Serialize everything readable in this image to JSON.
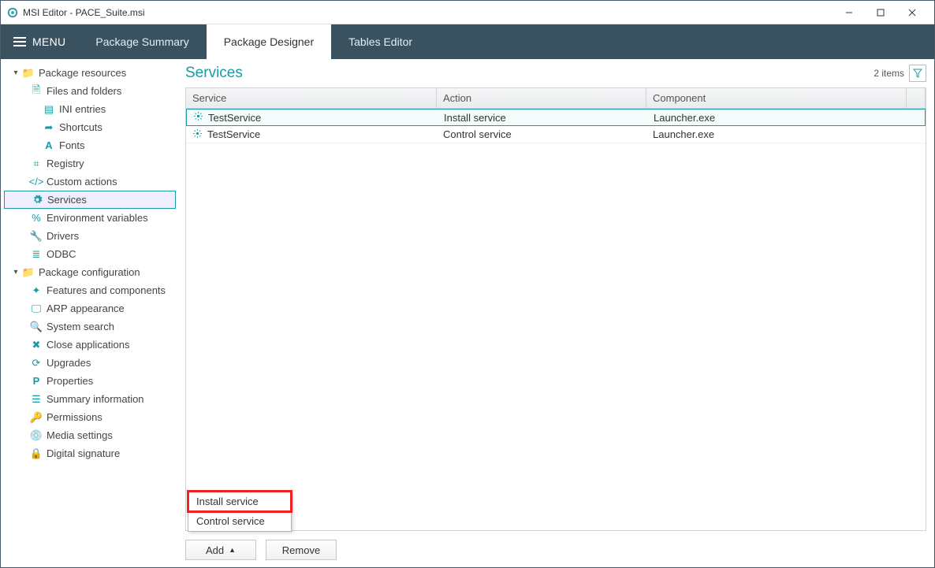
{
  "window": {
    "title": "MSI Editor - PACE_Suite.msi"
  },
  "menubar": {
    "menu_label": "MENU",
    "tabs": [
      {
        "label": "Package Summary",
        "active": false
      },
      {
        "label": "Package Designer",
        "active": true
      },
      {
        "label": "Tables Editor",
        "active": false
      }
    ]
  },
  "sidebar": {
    "sections": [
      {
        "label": "Package resources",
        "items": [
          {
            "label": "Files and folders",
            "icon": "file"
          },
          {
            "label": "INI entries",
            "icon": "ini",
            "depth": 3
          },
          {
            "label": "Shortcuts",
            "icon": "shortcut",
            "depth": 3
          },
          {
            "label": "Fonts",
            "icon": "font",
            "depth": 3
          },
          {
            "label": "Registry",
            "icon": "registry"
          },
          {
            "label": "Custom actions",
            "icon": "code"
          },
          {
            "label": "Services",
            "icon": "gear",
            "selected": true
          },
          {
            "label": "Environment variables",
            "icon": "percent"
          },
          {
            "label": "Drivers",
            "icon": "wrench"
          },
          {
            "label": "ODBC",
            "icon": "db"
          }
        ]
      },
      {
        "label": "Package configuration",
        "items": [
          {
            "label": "Features and components",
            "icon": "puzzle"
          },
          {
            "label": "ARP appearance",
            "icon": "monitor"
          },
          {
            "label": "System search",
            "icon": "search"
          },
          {
            "label": "Close applications",
            "icon": "close"
          },
          {
            "label": "Upgrades",
            "icon": "refresh"
          },
          {
            "label": "Properties",
            "icon": "p"
          },
          {
            "label": "Summary information",
            "icon": "doc"
          },
          {
            "label": "Permissions",
            "icon": "key"
          },
          {
            "label": "Media settings",
            "icon": "disc"
          },
          {
            "label": "Digital signature",
            "icon": "lock"
          }
        ]
      }
    ]
  },
  "main": {
    "title": "Services",
    "item_count": "2 items",
    "columns": {
      "service": "Service",
      "action": "Action",
      "component": "Component"
    },
    "rows": [
      {
        "service": "TestService",
        "action": "Install service",
        "component": "Launcher.exe",
        "selected": true
      },
      {
        "service": "TestService",
        "action": "Control service",
        "component": "Launcher.exe",
        "selected": false
      }
    ],
    "footer": {
      "add": "Add",
      "remove": "Remove"
    },
    "popup": {
      "items": [
        {
          "label": "Install service",
          "highlight": true
        },
        {
          "label": "Control service",
          "highlight": false
        }
      ]
    }
  }
}
